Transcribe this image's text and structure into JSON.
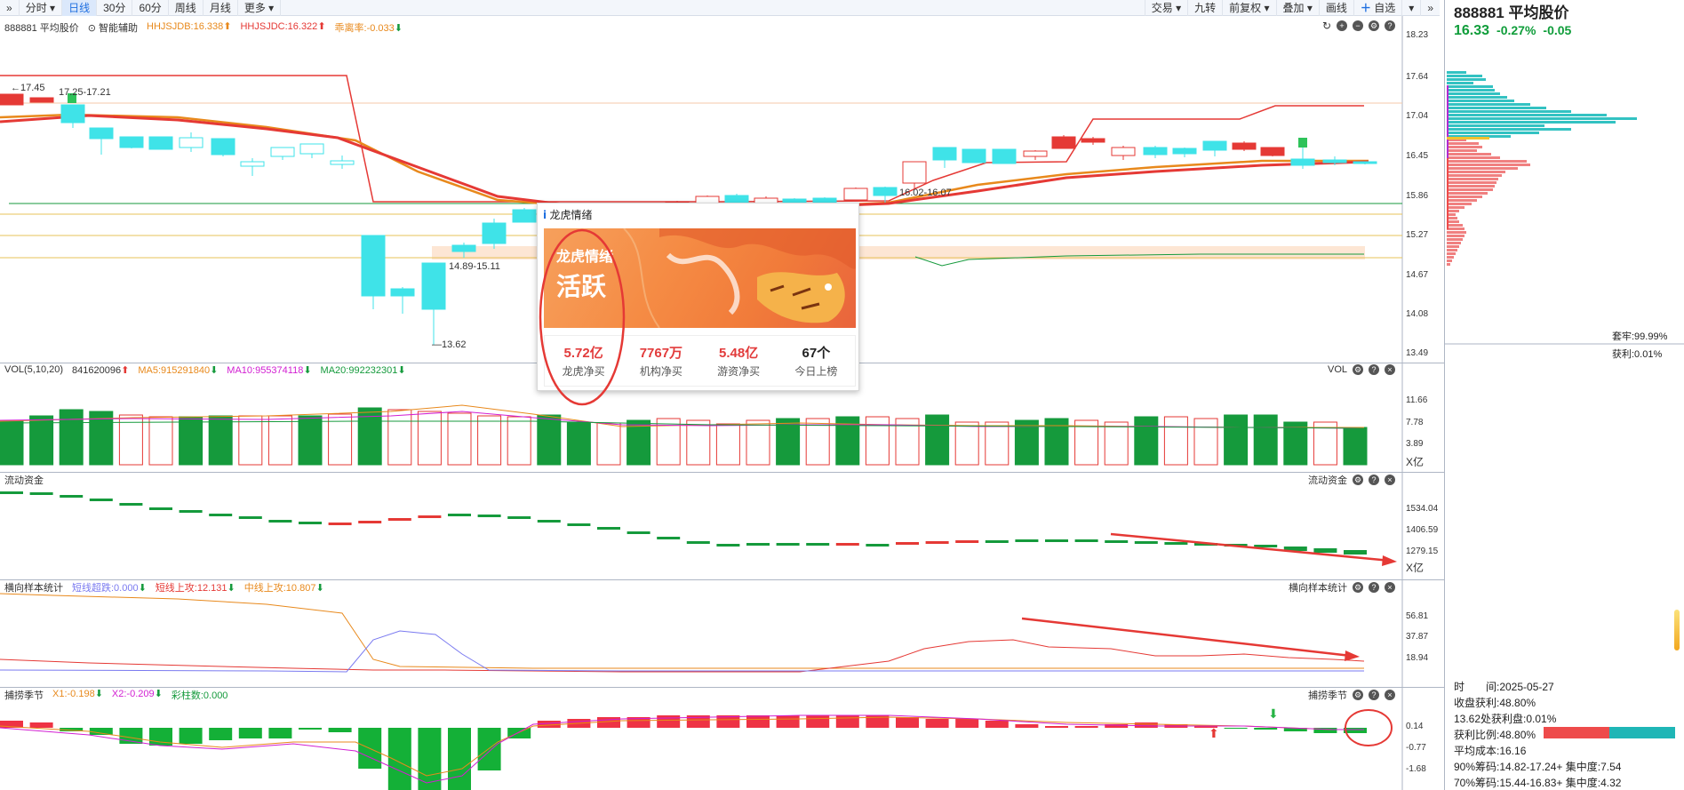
{
  "toolbar": {
    "left": [
      "分时",
      "日线",
      "30分",
      "60分",
      "周线",
      "月线",
      "更多"
    ],
    "active": "日线",
    "right": [
      "交易",
      "九转",
      "前复权",
      "叠加",
      "画线",
      "自选"
    ]
  },
  "main": {
    "stock": "888881 平均股价",
    "indicators": {
      "assist": "智能辅助",
      "hhjsjdb": "HHJSJDB:16.338",
      "hhjsjdc": "HHJSJDC:16.322",
      "deviation": "乖离率:-0.033"
    },
    "y_axis": [
      "18.23",
      "17.64",
      "17.04",
      "16.45",
      "15.86",
      "15.27",
      "14.67",
      "14.08",
      "13.49"
    ],
    "annotations": {
      "high_left": "17.45",
      "range1": "17.25-17.21",
      "range2": "14.89-15.11",
      "low": "13.62",
      "range3": "16.02-16.07"
    }
  },
  "vol": {
    "name": "VOL(5,10,20)",
    "value": "841620096",
    "ma5": "MA5:915291840",
    "ma10": "MA10:955374118",
    "ma20": "MA20:992232301",
    "tag": "VOL",
    "y_axis": [
      "11.66",
      "7.78",
      "3.89"
    ],
    "unit": "X亿"
  },
  "flow": {
    "name": "流动资金",
    "tag": "流动资金",
    "y_axis": [
      "1534.04",
      "1406.59",
      "1279.15"
    ],
    "unit": "X亿"
  },
  "sample": {
    "name": "横向样本统计",
    "short_drop": "短线超跌:0.000",
    "short_up": "短线上攻:12.131",
    "mid_up": "中线上攻:10.807",
    "tag": "横向样本统计",
    "y_axis": [
      "56.81",
      "37.87",
      "18.94"
    ]
  },
  "catch": {
    "name": "捕捞季节",
    "x1": "X1:-0.198",
    "x2": "X2:-0.209",
    "color_bars": "彩柱数:0.000",
    "tag": "捕捞季节",
    "y_axis": [
      "0.14",
      "-0.77",
      "-1.68"
    ]
  },
  "right": {
    "title": "888881 平均股价",
    "price": "16.33",
    "pct": "-0.27%",
    "change": "-0.05",
    "locked": "套牢:99.99%",
    "profit": "获利:0.01%",
    "time": "时　　间:2025-05-27",
    "profit_rate": "收盘获利:48.80%",
    "profit_at": "13.62处获利盘:0.01%",
    "profit_ratio": "获利比例:48.80%",
    "avg_cost": "平均成本:16.16",
    "chip90": "90%筹码:14.82-17.24+ 集中度:7.54",
    "chip70": "70%筹码:15.44-16.83+ 集中度:4.32"
  },
  "popup": {
    "title": "龙虎情绪",
    "banner_label": "龙虎情绪",
    "banner_value": "活跃",
    "stats": [
      {
        "value": "5.72亿",
        "label": "龙虎净买"
      },
      {
        "value": "7767万",
        "label": "机构净买"
      },
      {
        "value": "5.48亿",
        "label": "游资净买"
      },
      {
        "value": "67个",
        "label": "今日上榜"
      }
    ]
  },
  "colors": {
    "up": "#e53935",
    "down_cyan": "#3fe3e8",
    "down_green": "#159a3c",
    "orange": "#e8891c",
    "magenta": "#d21fd2"
  }
}
